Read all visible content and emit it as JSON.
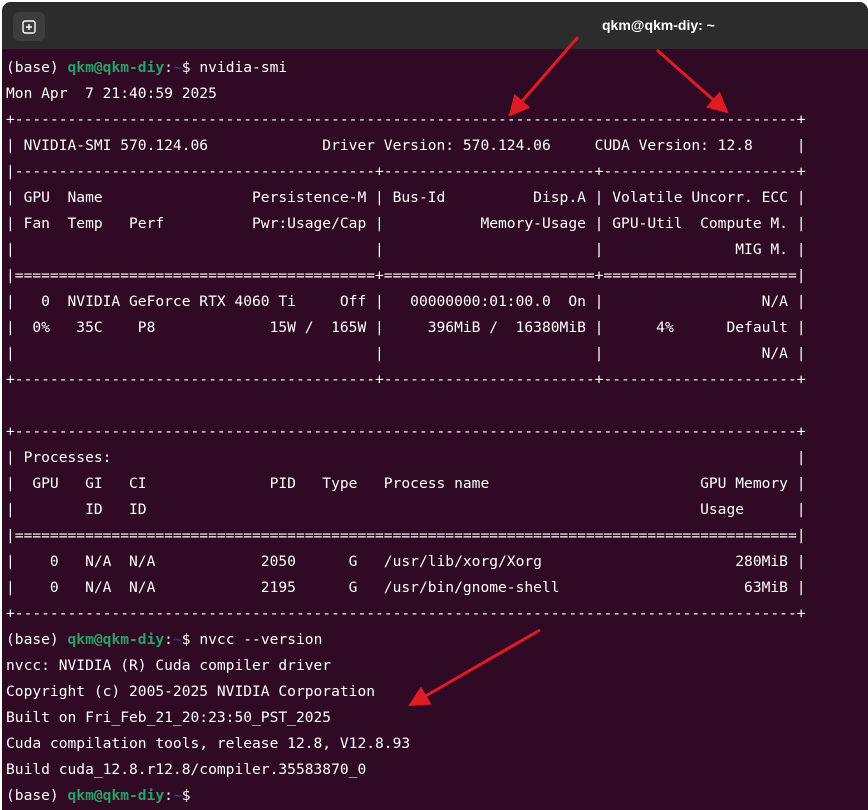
{
  "window": {
    "title": "qkm@qkm-diy: ~",
    "new_tab_icon": "new-tab-icon"
  },
  "prompt": {
    "env": "(base) ",
    "user_host": "qkm@qkm-diy",
    "sep": ":",
    "path": "~",
    "dollar": "$ "
  },
  "commands": {
    "first": "nvidia-smi",
    "second": "nvcc --version"
  },
  "smi_output": [
    "Mon Apr  7 21:40:59 2025",
    "+-----------------------------------------------------------------------------------------+",
    "| NVIDIA-SMI 570.124.06             Driver Version: 570.124.06     CUDA Version: 12.8     |",
    "|-----------------------------------------+------------------------+----------------------+",
    "| GPU  Name                 Persistence-M | Bus-Id          Disp.A | Volatile Uncorr. ECC |",
    "| Fan  Temp   Perf          Pwr:Usage/Cap |           Memory-Usage | GPU-Util  Compute M. |",
    "|                                         |                        |               MIG M. |",
    "|=========================================+========================+======================|",
    "|   0  NVIDIA GeForce RTX 4060 Ti     Off |   00000000:01:00.0  On |                  N/A |",
    "|  0%   35C    P8             15W /  165W |     396MiB /  16380MiB |      4%      Default |",
    "|                                         |                        |                  N/A |",
    "+-----------------------------------------+------------------------+----------------------+",
    "",
    "+-----------------------------------------------------------------------------------------+",
    "| Processes:                                                                              |",
    "|  GPU   GI   CI              PID   Type   Process name                        GPU Memory |",
    "|        ID   ID                                                               Usage      |",
    "|=========================================================================================|",
    "|    0   N/A  N/A            2050      G   /usr/lib/xorg/Xorg                      280MiB |",
    "|    0   N/A  N/A            2195      G   /usr/bin/gnome-shell                     63MiB |",
    "+-----------------------------------------------------------------------------------------+"
  ],
  "nvcc_output": [
    "nvcc: NVIDIA (R) Cuda compiler driver",
    "Copyright (c) 2005-2025 NVIDIA Corporation",
    "Built on Fri_Feb_21_20:23:50_PST_2025",
    "Cuda compilation tools, release 12.8, V12.8.93",
    "Build cuda_12.8.r12.8/compiler.35583870_0"
  ],
  "colors": {
    "terminal_bg": "#300a24",
    "titlebar_bg": "#2c2c2c",
    "prompt_user": "#26a269",
    "prompt_path": "#12488b",
    "arrow": "#e01b24"
  }
}
